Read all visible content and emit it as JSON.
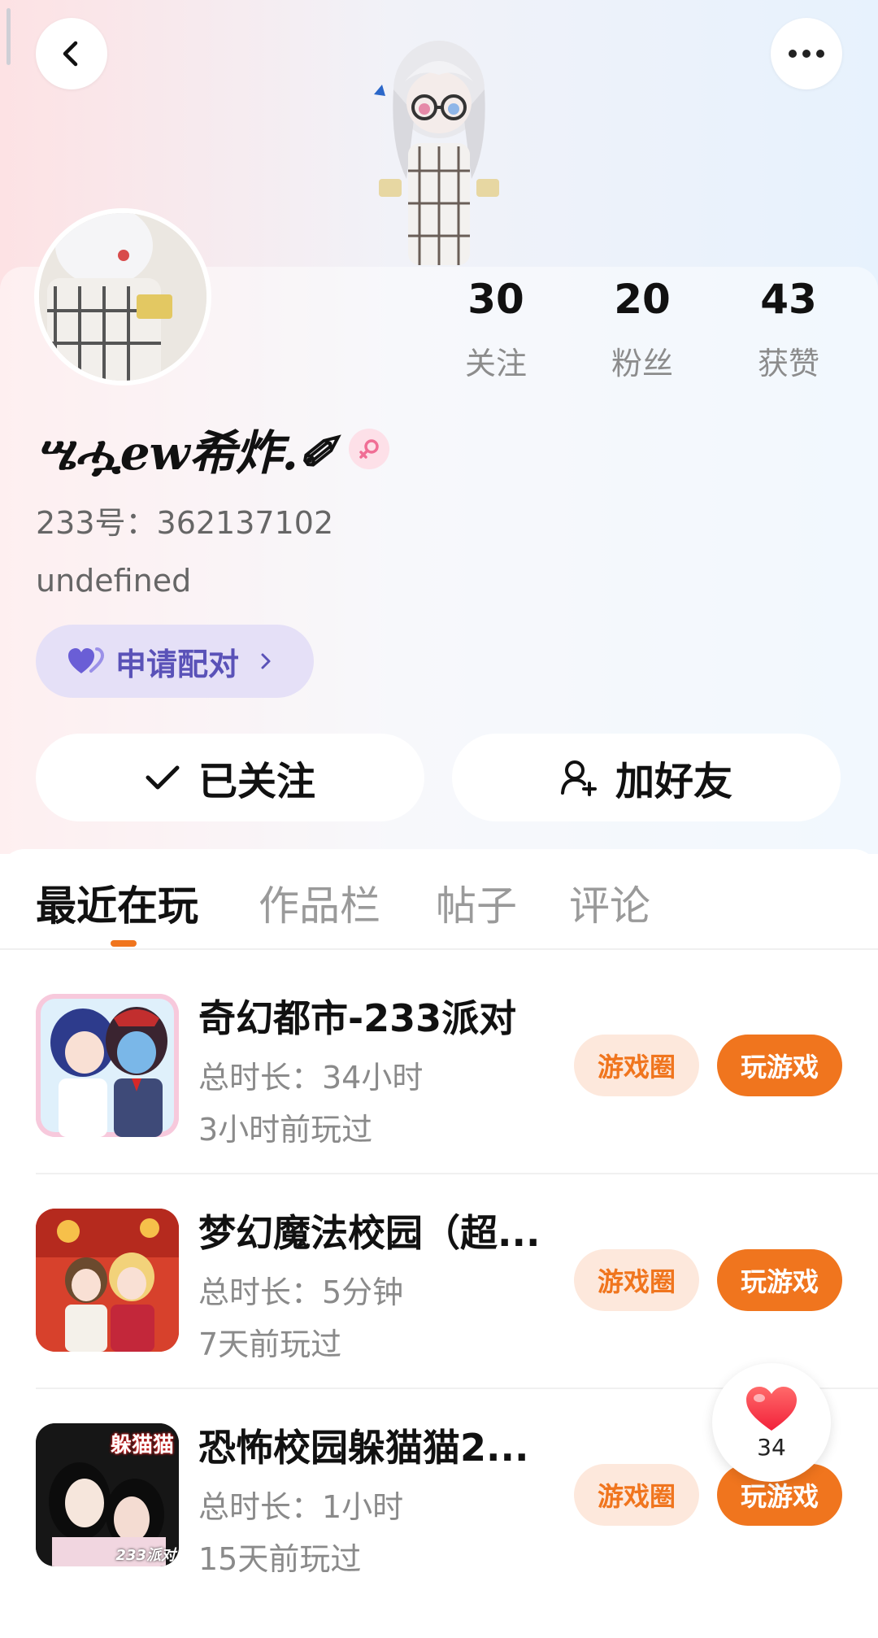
{
  "header": {
    "back_icon": "chevron-left-icon",
    "more_icon": "more-dots-icon"
  },
  "stats": [
    {
      "value": "30",
      "label": "关注"
    },
    {
      "value": "20",
      "label": "粉丝"
    },
    {
      "value": "43",
      "label": "获赞"
    }
  ],
  "profile": {
    "username": "ሤሗew希炸.✐",
    "gender": "female",
    "uid": "233号：362137102",
    "bio": "undefined",
    "pair_label": "申请配对"
  },
  "actions": {
    "follow_label": "已关注",
    "add_friend_label": "加好友"
  },
  "tabs": [
    "最近在玩",
    "作品栏",
    "帖子",
    "评论"
  ],
  "games": [
    {
      "title": "奇幻都市-233派对",
      "duration": "总时长：34小时",
      "last_played": "3小时前玩过",
      "circle_label": "游戏圈",
      "play_label": "玩游戏"
    },
    {
      "title": "梦幻魔法校园（超...",
      "duration": "总时长：5分钟",
      "last_played": "7天前玩过",
      "circle_label": "游戏圈",
      "play_label": "玩游戏"
    },
    {
      "title": "恐怖校园躲猫猫2...",
      "duration": "总时长：1小时",
      "last_played": "15天前玩过",
      "circle_label": "游戏圈",
      "play_label": "玩游戏",
      "icon_caption": "躲猫猫",
      "icon_brand": "233派对"
    }
  ],
  "like_float": {
    "count": "34"
  },
  "colors": {
    "accent": "#f0751e",
    "pair_text": "#5a52b8",
    "pair_bg": "#e5e0f7"
  }
}
